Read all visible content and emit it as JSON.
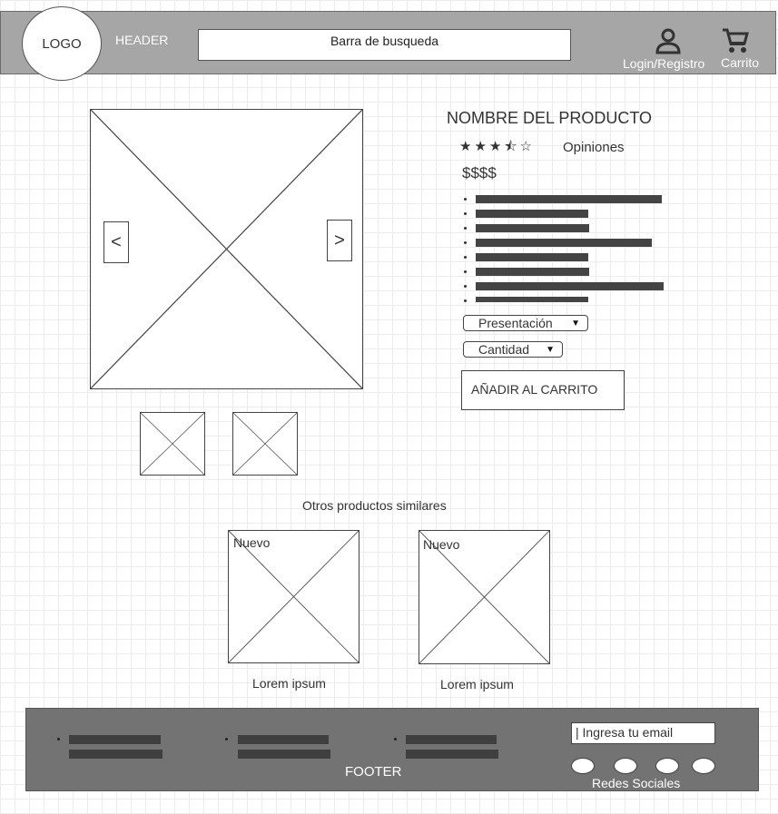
{
  "header": {
    "logo": "LOGO",
    "label": "HEADER",
    "search_text": "Barra de busqueda",
    "login_label": "Login/Registro",
    "cart_label": "Carrito"
  },
  "gallery": {
    "prev": "<",
    "next": ">"
  },
  "product": {
    "name": "NOMBRE DEL PRODUCTO",
    "rating": 3.5,
    "rating_max": 5,
    "stars_text": "★★★⯪☆",
    "reviews_label": "Opiniones",
    "price": "$$$$",
    "presentation_select": "Presentación",
    "quantity_select": "Cantidad",
    "add_to_cart": "AÑADIR AL CARRITO"
  },
  "similar": {
    "title": "Otros productos similares",
    "items": [
      {
        "badge": "Nuevo",
        "caption": "Lorem ipsum"
      },
      {
        "badge": "Nuevo",
        "caption": "Lorem ipsum"
      }
    ]
  },
  "footer": {
    "label": "FOOTER",
    "email_placeholder": "|   Ingresa tu email",
    "social_label": "Redes Sociales"
  },
  "icons": {
    "user": "user-icon",
    "cart": "cart-icon"
  },
  "colors": {
    "header_bg": "#a6a6a6",
    "footer_bg": "#737373",
    "text_bar": "#444444"
  }
}
